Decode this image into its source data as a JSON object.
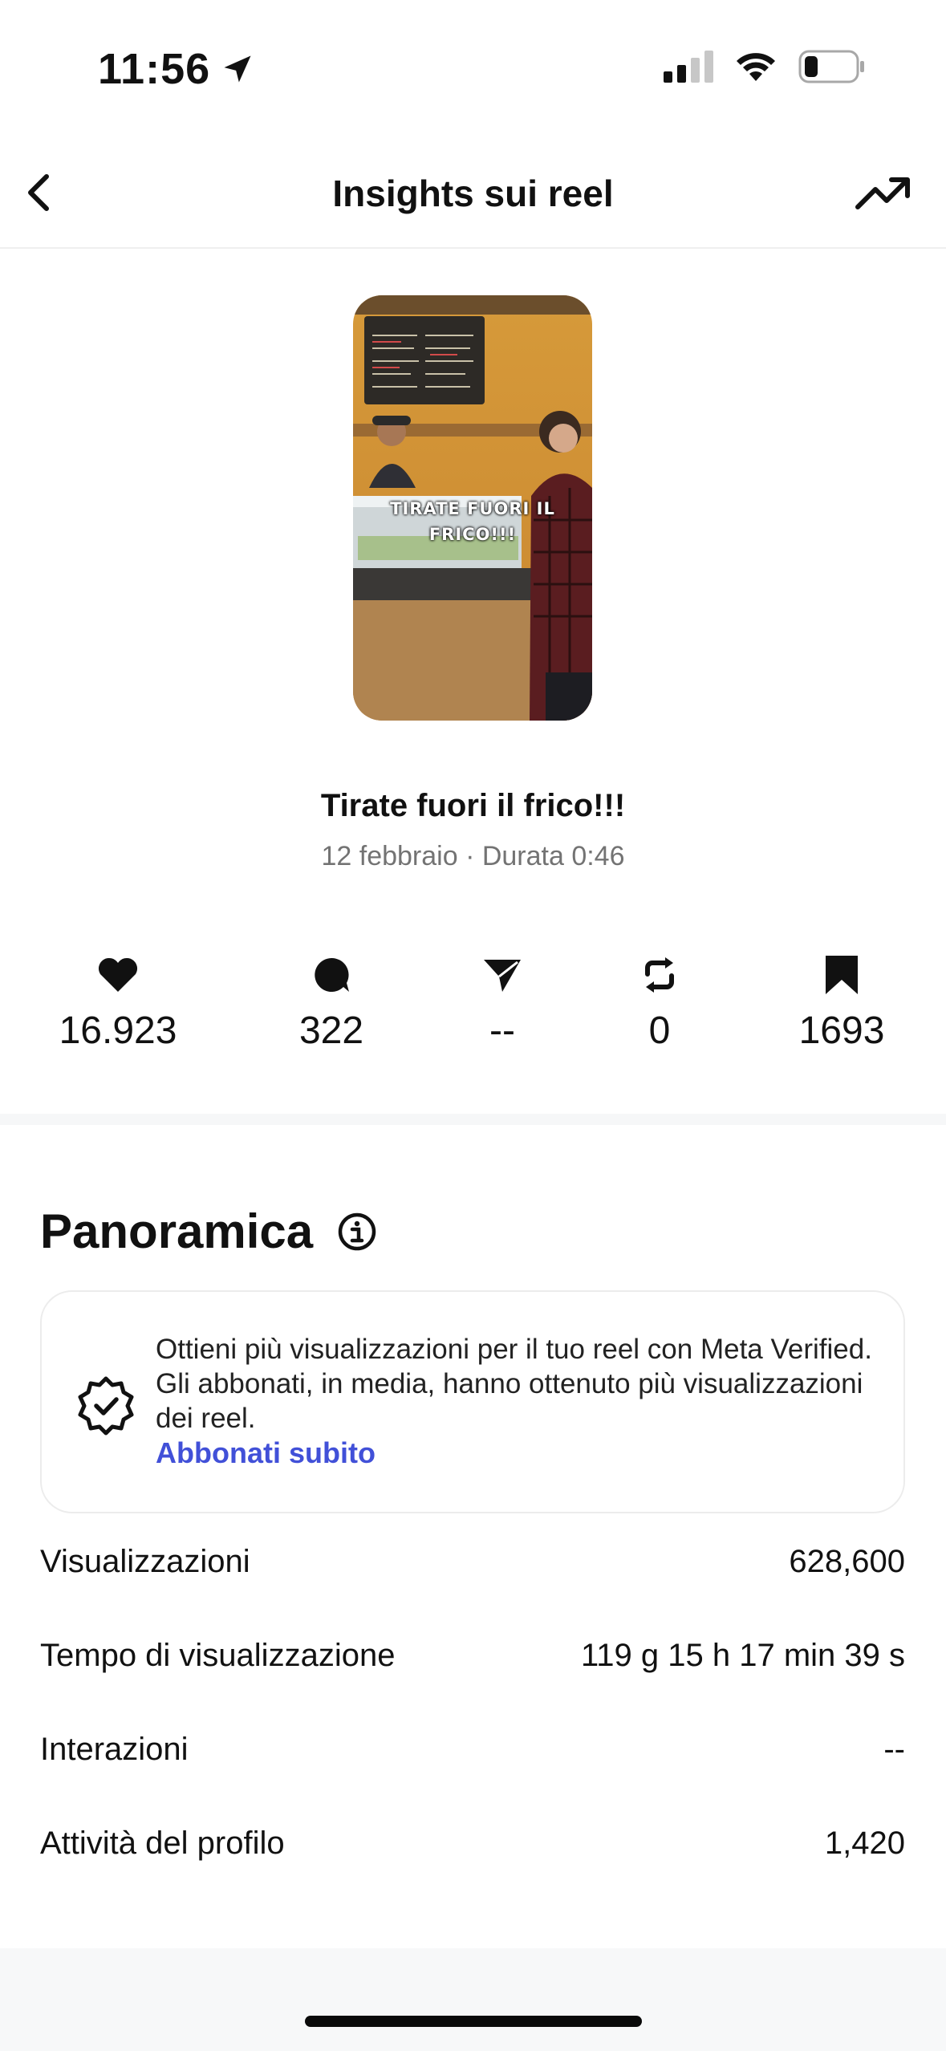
{
  "status": {
    "time": "11:56"
  },
  "nav": {
    "title": "Insights sui reel"
  },
  "reel": {
    "overlay_text_line1": "TIRATE FUORI IL",
    "overlay_text_line2": "FRICO!!!",
    "title": "Tirate fuori il frico!!!",
    "meta": "12 febbraio · Durata 0:46"
  },
  "metrics": [
    {
      "icon": "heart-icon",
      "value": "16.923"
    },
    {
      "icon": "comment-icon",
      "value": "322"
    },
    {
      "icon": "send-icon",
      "value": "--"
    },
    {
      "icon": "repost-icon",
      "value": "0"
    },
    {
      "icon": "bookmark-icon",
      "value": "1693"
    }
  ],
  "overview": {
    "title": "Panoramica",
    "promo_text": "Ottieni più visualizzazioni per il tuo reel con Meta Verified. Gli abbonati, in media, hanno ottenuto più visualizzazioni dei reel.",
    "promo_link": "Abbonati subito",
    "rows": [
      {
        "label": "Visualizzazioni",
        "value": "628,600"
      },
      {
        "label": "Tempo di visualizzazione",
        "value": "119 g 15 h 17 min 39 s"
      },
      {
        "label": "Interazioni",
        "value": "--"
      },
      {
        "label": "Attività del profilo",
        "value": "1,420"
      }
    ]
  },
  "colors": {
    "accent_link": "#4150d8",
    "muted_text": "#737373"
  }
}
